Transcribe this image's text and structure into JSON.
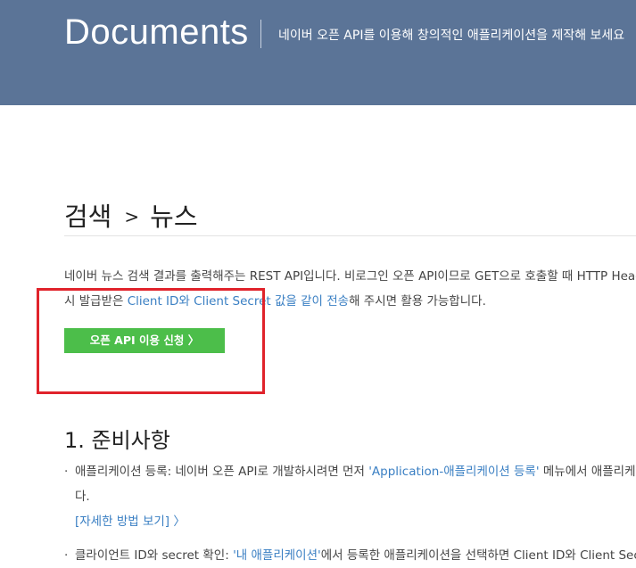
{
  "header": {
    "title": "Documents",
    "description": "네이버 오픈 API를 이용해 창의적인 애플리케이션을 제작해 보세요"
  },
  "breadcrumb": {
    "parent": "검색",
    "separator": ">",
    "current": "뉴스"
  },
  "intro": {
    "line1": "네이버 뉴스 검색 결과를 출력해주는 REST API입니다. 비로그인 오픈 API이므로 GET으로 호출할 때 HTTP Header에",
    "line2_prefix": "시 발급받은 ",
    "line2_link": "Client ID와 Client Secret 값을 같이 전송",
    "line2_suffix": "해 주시면 활용 가능합니다."
  },
  "apply_button": {
    "label": "오픈 API 이용 신청 〉"
  },
  "section": {
    "title": "1. 준비사항"
  },
  "bullets": [
    {
      "dot": "·",
      "prefix": "애플리케이션 등록: 네이버 오픈 API로 개발하시려면 먼저 ",
      "link": "'Application-애플리케이션 등록'",
      "suffix": " 메뉴에서 애플리케이션을 등록하셔야 합니",
      "continuation": "다.",
      "detail_link": "[자세한 방법 보기] 〉"
    },
    {
      "dot": "·",
      "prefix": "클라이언트 ID와 secret 확인: ",
      "link": "'내 애플리케이션'",
      "suffix": "에서 등록한 애플리케이션을 선택하면 Client ID와 Client Secret 값을 확인할 수 있습니다."
    }
  ],
  "colors": {
    "header_bg": "#5b7497",
    "link": "#3a7fc3",
    "button_bg": "#4cbe4a",
    "highlight_border": "#e0232b"
  }
}
